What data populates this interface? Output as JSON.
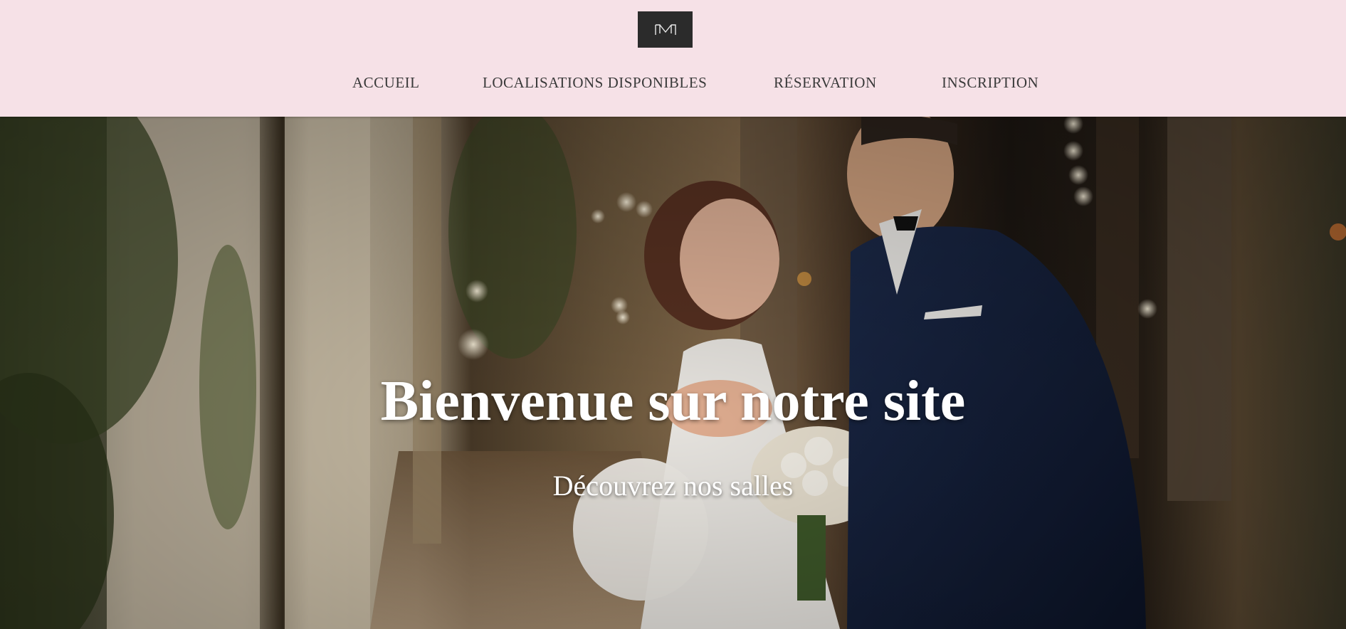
{
  "header": {
    "logo_icon": "monogram-m-logo",
    "colors": {
      "background": "#f6e1e7",
      "logo_background": "#2b2b2b",
      "nav_text": "#3a3a3a"
    },
    "nav": [
      {
        "label": "ACCUEIL"
      },
      {
        "label": "LOCALISATIONS DISPONIBLES"
      },
      {
        "label": "RÉSERVATION"
      },
      {
        "label": "INSCRIPTION"
      }
    ]
  },
  "hero": {
    "title": "Bienvenue sur notre site",
    "subtitle": "Découvrez nos salles",
    "image_icon": "wedding-couple-photo",
    "colors": {
      "text": "#ffffff"
    }
  }
}
